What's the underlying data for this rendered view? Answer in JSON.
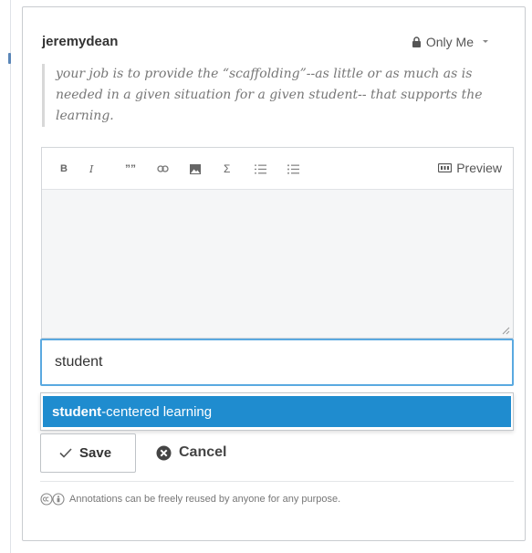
{
  "annotation": {
    "username": "jeremydean",
    "privacy_label": "Only Me",
    "quote": "your job is to provide the “scaffolding”--as little or as much as is needed in a given situation for a given student-- that supports the learning."
  },
  "editor": {
    "toolbar": {
      "bold": "B",
      "italic": "I",
      "quote": "””",
      "sigma": "Σ",
      "preview_label": "Preview"
    },
    "body_value": ""
  },
  "tags": {
    "input_value": "student",
    "suggestion_match": "student",
    "suggestion_rest": "-centered learning"
  },
  "actions": {
    "save_label": "Save",
    "cancel_label": "Cancel"
  },
  "footer": {
    "license_text": "Annotations can be freely reused by anyone for any purpose."
  },
  "colors": {
    "accent": "#1f8ccf",
    "focus_border": "#5aa9e0"
  },
  "icons": [
    "lock-icon",
    "caret-down-icon",
    "link-icon",
    "image-icon",
    "ordered-list-icon",
    "unordered-list-icon",
    "preview-icon",
    "checkmark-icon",
    "cancel-circle-icon",
    "creative-commons-icon"
  ]
}
